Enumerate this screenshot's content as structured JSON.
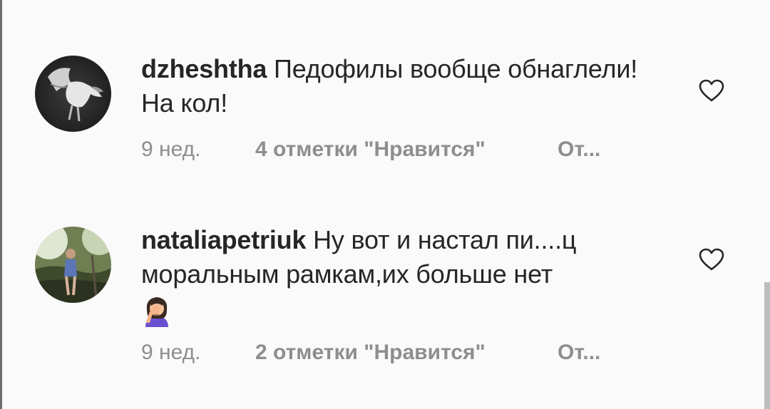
{
  "comments": [
    {
      "username": "dzheshtha",
      "text": "Педофилы вообще обнаглели! На кол!",
      "time": "9 нед.",
      "likes": "4 отметки \"Нравится\"",
      "reply": "От..."
    },
    {
      "username": "nataliapetriuk",
      "text": "Ну вот и настал пи....ц моральным рамкам,их больше нет",
      "emoji": "woman-facepalming",
      "time": "9 нед.",
      "likes": "2 отметки \"Нравится\"",
      "reply": "От..."
    }
  ],
  "icons": {
    "like": "heart-outline-icon"
  },
  "colors": {
    "background": "#fafafa",
    "text": "#262626",
    "secondary": "#8e8e8e"
  }
}
